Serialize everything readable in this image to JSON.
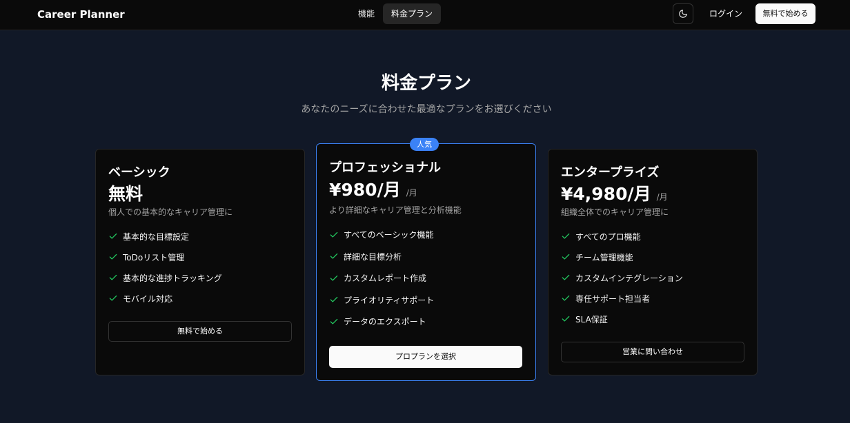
{
  "header": {
    "brand": "Career Planner",
    "nav": [
      {
        "label": "機能",
        "active": false
      },
      {
        "label": "料金プラン",
        "active": true
      }
    ],
    "theme_icon": "moon-icon",
    "login_label": "ログイン",
    "cta_label": "無料で始める"
  },
  "hero": {
    "title": "料金プラン",
    "subtitle": "あなたのニーズに合わせた最適なプランをお選びください"
  },
  "plans": [
    {
      "name": "ベーシック",
      "price": "無料",
      "unit": "",
      "description": "個人での基本的なキャリア管理に",
      "features": [
        "基本的な目標設定",
        "ToDoリスト管理",
        "基本的な進捗トラッキング",
        "モバイル対応"
      ],
      "button_label": "無料で始める",
      "featured": false
    },
    {
      "badge": "人気",
      "name": "プロフェッショナル",
      "price": "¥980/月",
      "unit": "/月",
      "description": "より詳細なキャリア管理と分析機能",
      "features": [
        "すべてのベーシック機能",
        "詳細な目標分析",
        "カスタムレポート作成",
        "プライオリティサポート",
        "データのエクスポート"
      ],
      "button_label": "プロプランを選択",
      "featured": true
    },
    {
      "name": "エンタープライズ",
      "price": "¥4,980/月",
      "unit": "/月",
      "description": "組織全体でのキャリア管理に",
      "features": [
        "すべてのプロ機能",
        "チーム管理機能",
        "カスタムインテグレーション",
        "専任サポート担当者",
        "SLA保証"
      ],
      "button_label": "営業に問い合わせ",
      "featured": false
    }
  ],
  "colors": {
    "background": "#111827",
    "header": "#0a0a0a",
    "card": "#0a0a0a",
    "accent": "#3b82f6",
    "check": "#22c55e"
  }
}
